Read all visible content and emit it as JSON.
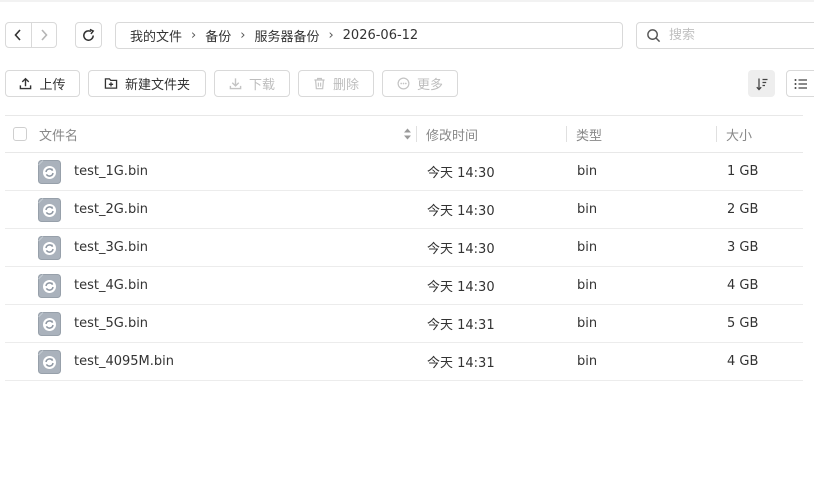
{
  "breadcrumb": [
    "我的文件",
    "备份",
    "服务器备份",
    "2026-06-12"
  ],
  "search": {
    "placeholder": "搜索"
  },
  "toolbar": {
    "upload": "上传",
    "new_folder": "新建文件夹",
    "download": "下载",
    "delete": "删除",
    "more": "更多"
  },
  "table": {
    "headers": {
      "name": "文件名",
      "modified": "修改时间",
      "type": "类型",
      "size": "大小"
    },
    "rows": [
      {
        "name": "test_1G.bin",
        "modified": "今天 14:30",
        "type": "bin",
        "size": "1 GB"
      },
      {
        "name": "test_2G.bin",
        "modified": "今天 14:30",
        "type": "bin",
        "size": "2 GB"
      },
      {
        "name": "test_3G.bin",
        "modified": "今天 14:30",
        "type": "bin",
        "size": "3 GB"
      },
      {
        "name": "test_4G.bin",
        "modified": "今天 14:30",
        "type": "bin",
        "size": "4 GB"
      },
      {
        "name": "test_5G.bin",
        "modified": "今天 14:31",
        "type": "bin",
        "size": "5 GB"
      },
      {
        "name": "test_4095M.bin",
        "modified": "今天 14:31",
        "type": "bin",
        "size": "4 GB"
      }
    ]
  },
  "icons": {
    "back": "chevron-left-icon",
    "forward": "chevron-right-icon",
    "refresh": "refresh-icon",
    "search": "search-icon",
    "upload": "upload-icon",
    "new_folder": "folder-plus-icon",
    "download": "download-icon",
    "delete": "trash-icon",
    "more": "more-circle-icon",
    "sort": "sort-icon",
    "list_view": "list-view-icon",
    "file": "binary-file-icon"
  },
  "colors": {
    "border": "#d9d9d9",
    "disabled_text": "#bdbdbd",
    "file_icon": "#9aa3ad"
  }
}
